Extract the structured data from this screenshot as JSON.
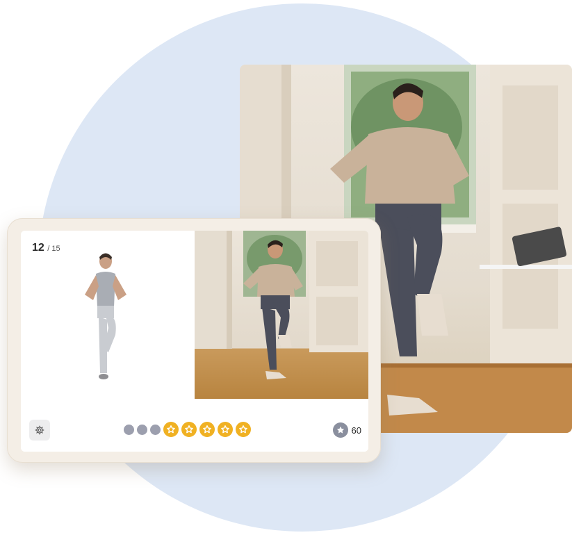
{
  "progress": {
    "current": "12",
    "total": "/ 15"
  },
  "stars": {
    "grey_dots": 3,
    "filled_stars": 5,
    "score": "60"
  },
  "colors": {
    "accent": "#f0b123",
    "dot": "#9c9fae",
    "circle": "#dde7f5"
  },
  "icons": {
    "settings": "gear-icon",
    "score": "star-icon",
    "progress": "star-icon"
  }
}
